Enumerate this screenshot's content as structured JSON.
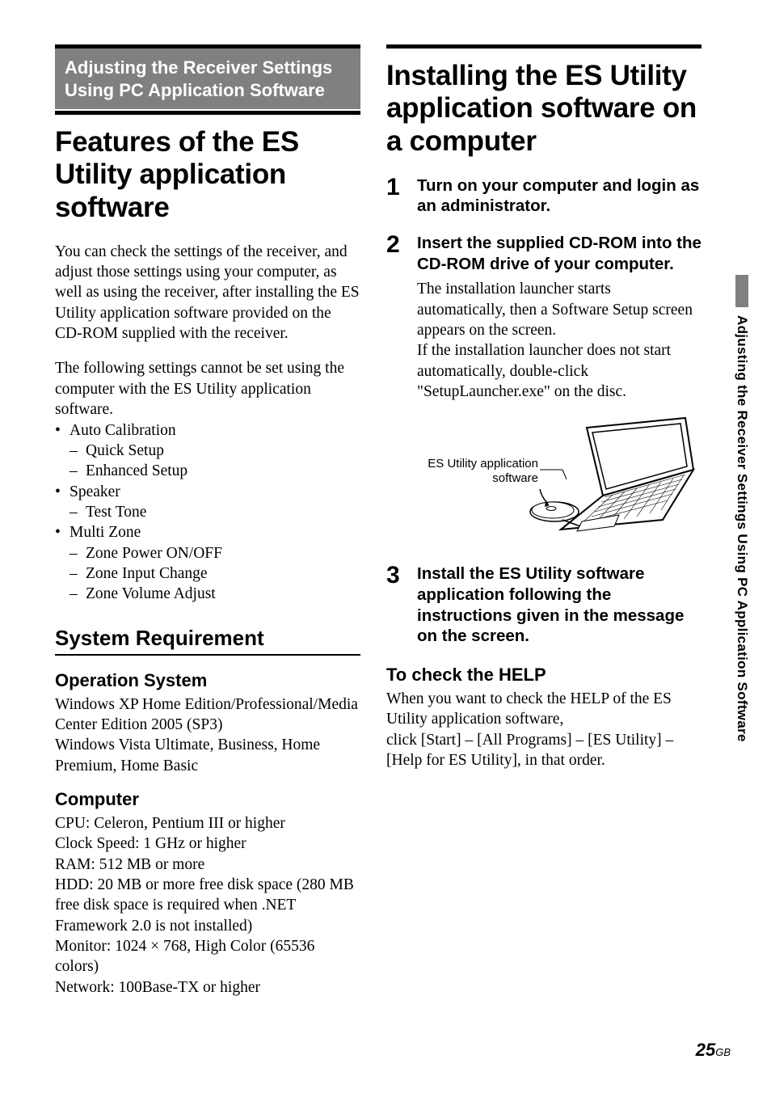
{
  "left": {
    "sectionHeader": "Adjusting the Receiver Settings Using PC Application Software",
    "title": "Features of the ES Utility application software",
    "intro": "You can check the settings of the receiver, and adjust those settings using your computer, as well as using the receiver, after installing the ES Utility application software provided on the CD-ROM supplied with the receiver.",
    "noteLead": "The following settings cannot be set using the computer with the ES Utility application software.",
    "bullets": [
      {
        "label": "Auto Calibration",
        "subs": [
          "Quick Setup",
          "Enhanced Setup"
        ]
      },
      {
        "label": "Speaker",
        "subs": [
          "Test Tone"
        ]
      },
      {
        "label": "Multi Zone",
        "subs": [
          "Zone Power ON/OFF",
          "Zone Input Change",
          "Zone Volume Adjust"
        ]
      }
    ],
    "sysReqHeading": "System Requirement",
    "osHeading": "Operation System",
    "osBody": "Windows XP Home Edition/Professional/Media Center Edition 2005 (SP3)\nWindows Vista Ultimate, Business, Home Premium, Home Basic",
    "compHeading": "Computer",
    "compBody": "CPU: Celeron, Pentium III or higher\nClock Speed: 1 GHz or higher\nRAM: 512 MB or more\nHDD: 20 MB or more free disk space (280 MB free disk space is required when .NET Framework 2.0 is not installed)\nMonitor: 1024 × 768, High Color (65536 colors)\nNetwork: 100Base-TX or higher"
  },
  "right": {
    "title": "Installing the ES Utility application software on a computer",
    "steps": [
      {
        "num": "1",
        "title": "Turn on your computer and login as an administrator.",
        "body": ""
      },
      {
        "num": "2",
        "title": "Insert the supplied CD-ROM into the CD-ROM drive of your computer.",
        "body": "The installation launcher starts automatically, then a Software Setup screen appears on the screen.\nIf the installation launcher does not start automatically, double-click \"SetupLauncher.exe\" on the disc."
      },
      {
        "num": "3",
        "title": "Install the ES Utility software application following the instructions given in the message on the screen.",
        "body": ""
      }
    ],
    "figLabel": "ES Utility application software",
    "helpHeading": "To check the HELP",
    "helpBody": "When you want to check the HELP of the ES Utility application software,\nclick [Start] – [All Programs] – [ES Utility] – [Help for ES Utility], in that order."
  },
  "sideTab": "Adjusting the Receiver Settings Using PC Application Software",
  "pageNum": "25",
  "pageSuffix": "GB"
}
